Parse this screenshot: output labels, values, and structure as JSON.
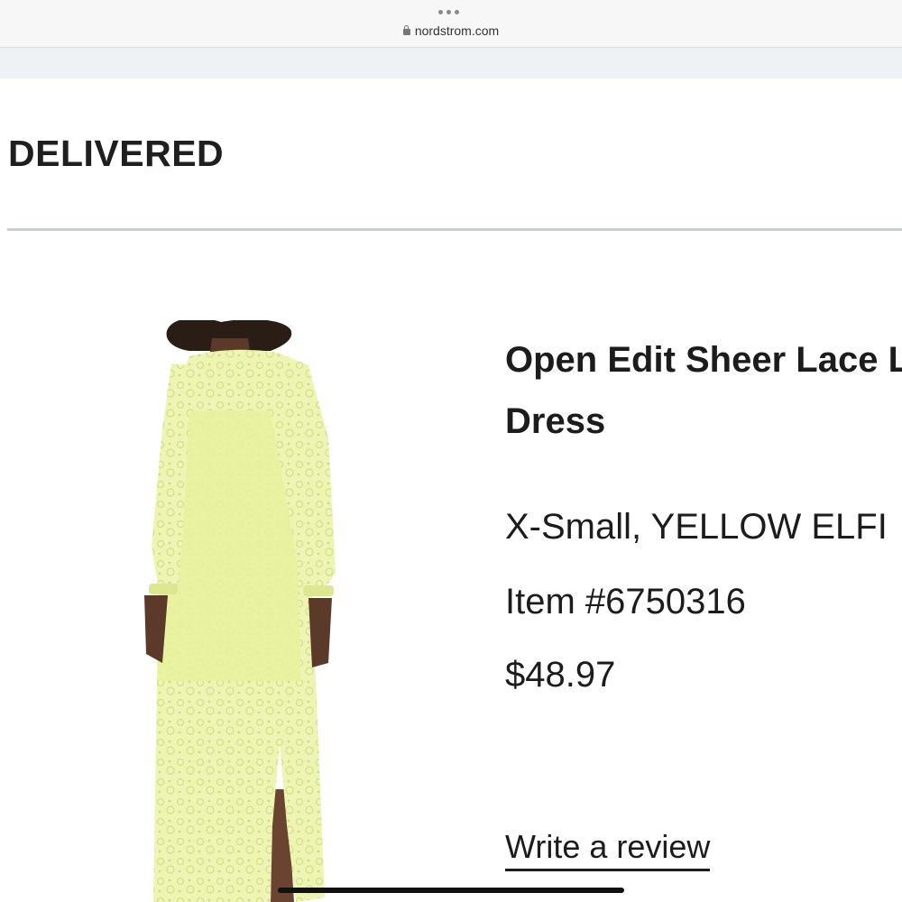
{
  "browser": {
    "url": "nordstrom.com",
    "lock_icon": "lock-icon"
  },
  "order": {
    "status": "DELIVERED"
  },
  "product": {
    "title_line1": "Open Edit Sheer Lace L",
    "title_line2": "Dress",
    "variant": "X-Small, YELLOW ELFI",
    "item_number": "Item #6750316",
    "price": "$48.97",
    "review_link": "Write a review",
    "image": "yellow sheer lace long-sleeve maxi dress worn by model",
    "dress_color": "#eef5b4"
  }
}
